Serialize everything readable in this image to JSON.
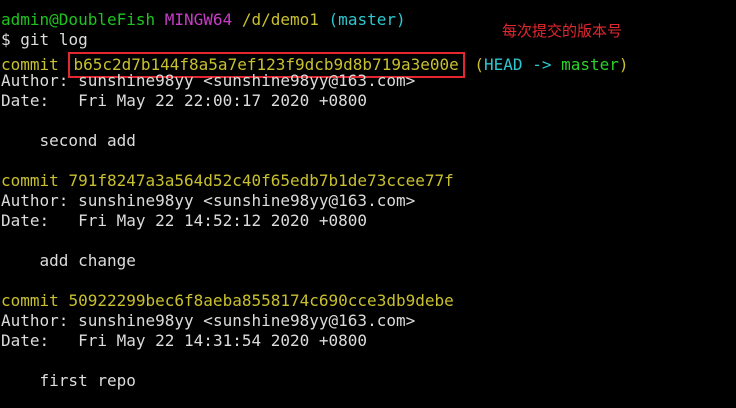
{
  "prompt": {
    "user_host": "admin@DoubleFish",
    "system": "MINGW64",
    "path": "/d/demo1",
    "branch": "(master)"
  },
  "command": {
    "symbol": "$",
    "text": "git log"
  },
  "annotation": "每次提交的版本号",
  "commits": [
    {
      "keyword": "commit",
      "hash": "b65c2d7b144f8a5a7ef123f9dcb9d8b719a3e00e",
      "ref_open": "(",
      "ref_head": "HEAD",
      "ref_arrow": "->",
      "ref_branch": "master",
      "ref_close": ")",
      "author_label": "Author:",
      "author": "sunshine98yy <sunshine98yy@163.com>",
      "date_label": "Date:",
      "date": "Fri May 22 22:00:17 2020 +0800",
      "message": "second add"
    },
    {
      "keyword": "commit",
      "hash": "791f8247a3a564d52c40f65edb7b1de73ccee77f",
      "author_label": "Author:",
      "author": "sunshine98yy <sunshine98yy@163.com>",
      "date_label": "Date:",
      "date": "Fri May 22 14:52:12 2020 +0800",
      "message": "add change"
    },
    {
      "keyword": "commit",
      "hash": "50922299bec6f8aeba8558174c690cce3db9debe",
      "author_label": "Author:",
      "author": "sunshine98yy <sunshine98yy@163.com>",
      "date_label": "Date:",
      "date": "Fri May 22 14:31:54 2020 +0800",
      "message": "first repo"
    }
  ],
  "colors": {
    "background": "#000000",
    "prompt_user": "#1ec41e",
    "prompt_system": "#c73cc7",
    "prompt_path": "#c8c02e",
    "prompt_branch": "#2ec6cf",
    "commit_line": "#c8c02e",
    "ref_head": "#2ec6cf",
    "ref_branch": "#2bd22b",
    "text": "#dcdcdc",
    "highlight_box": "#e3262f"
  }
}
